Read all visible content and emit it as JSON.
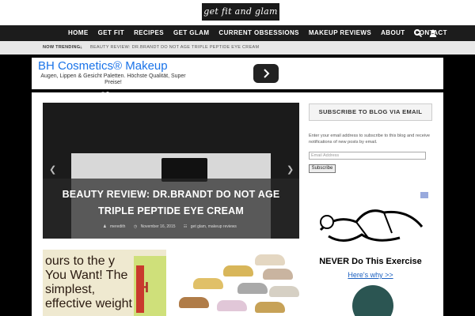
{
  "header": {
    "logo_text": "get fit and glam"
  },
  "nav": {
    "items": [
      "HOME",
      "GET FIT",
      "RECIPES",
      "GET GLAM",
      "CURRENT OBSESSIONS",
      "MAKEUP REVIEWS",
      "ABOUT",
      "CONTACT"
    ],
    "icons": [
      "search-icon",
      "user-icon"
    ]
  },
  "trending": {
    "label": "NOW TRENDING:",
    "arrow": "→",
    "text": "BEAUTY REVIEW: DR.BRANDT DO NOT AGE TRIPLE PEPTIDE EYE CREAM"
  },
  "ad": {
    "title": "BH Cosmetics® Makeup",
    "description": "Augen, Lippen & Gesicht Paletten. Höchste Qualität, Super Preise!",
    "button_icon": "chevron-right-icon"
  },
  "slider": {
    "title": "BEAUTY REVIEW: DR.BRANDT DO NOT AGE TRIPLE PEPTIDE EYE CREAM",
    "author": "meredith",
    "date": "November 16, 2015",
    "categories": "get glam, makeup reviews",
    "prev_icon": "chevron-left-icon",
    "next_icon": "chevron-right-icon"
  },
  "sidebar": {
    "heading": "SUBSCRIBE TO BLOG VIA EMAIL",
    "description": "Enter your email address to subscribe to this blog and receive notifications of new posts by email.",
    "email_placeholder": "Email Address",
    "subscribe_label": "Subscribe",
    "ad_title": "NEVER Do This Exercise",
    "ad_link": "Here's why >>"
  },
  "posts": {
    "post1_text": "ours to the y You Want! The simplest, effective weight",
    "post1_book_letter": "H"
  },
  "colors": {
    "nav_bg": "#1c1c1c",
    "trending_bg": "#e8e8e8",
    "ad_title": "#1a73e8",
    "link_blue": "#1a5fc0"
  }
}
